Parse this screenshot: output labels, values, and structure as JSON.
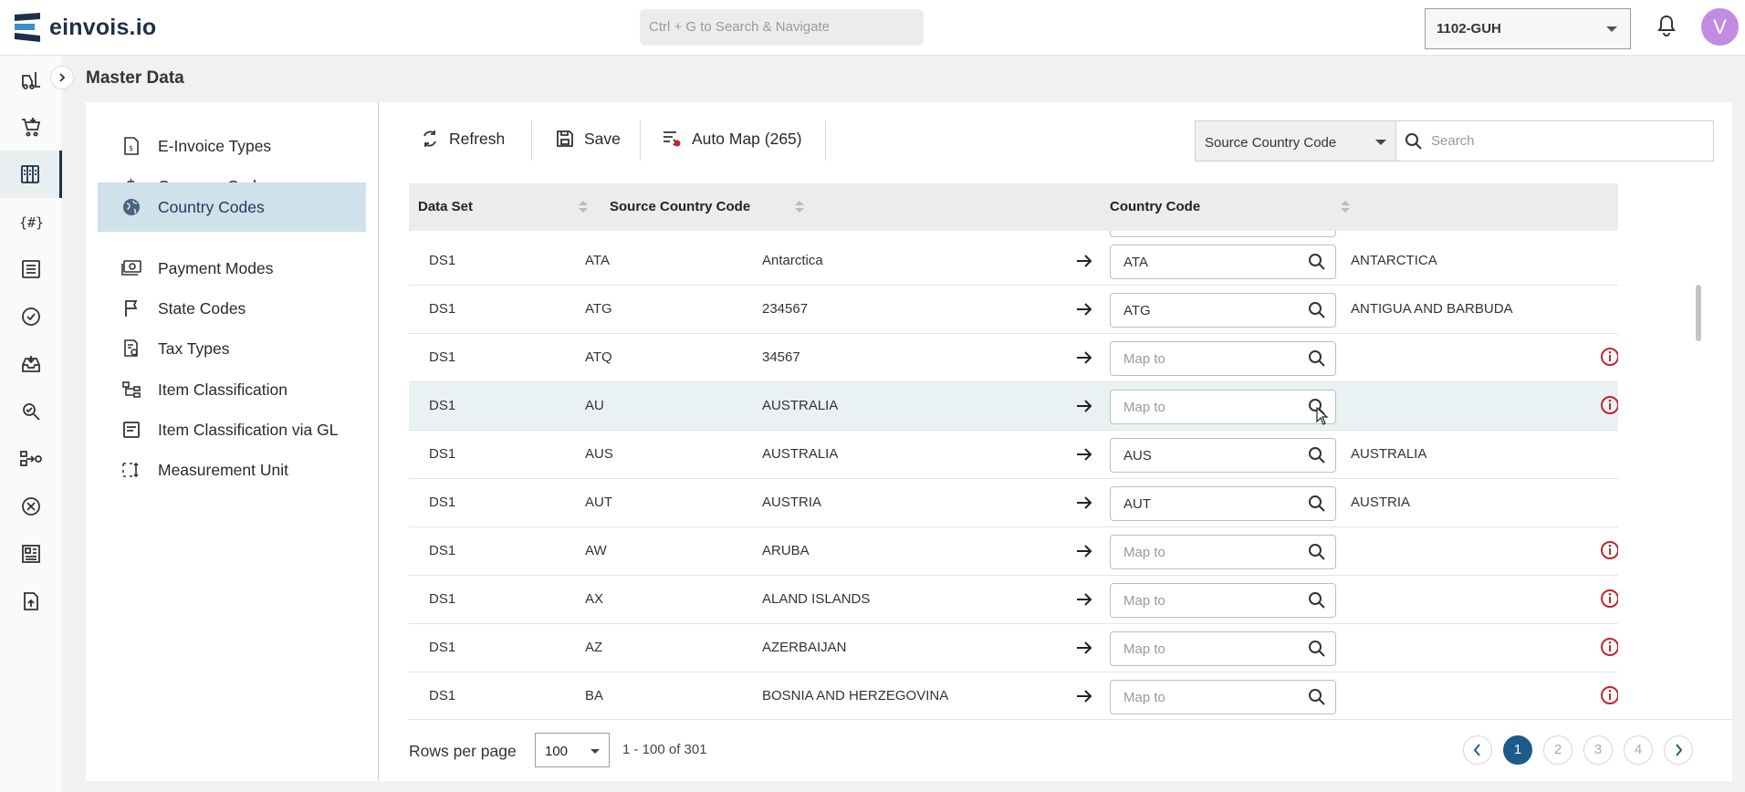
{
  "app": {
    "name": "einvois.io",
    "search_placeholder": "Ctrl + G to Search & Navigate",
    "company": "1102-GUH",
    "user_initial": "V"
  },
  "page": {
    "title": "Master Data"
  },
  "subnav": {
    "items": [
      {
        "label": "E-Invoice Types",
        "icon": "invoice-doc-icon",
        "active": false
      },
      {
        "label": "Currency Codes",
        "icon": "dollar-icon",
        "active": false
      },
      {
        "label": "Country Codes",
        "icon": "globe-icon",
        "active": true
      },
      {
        "label": "Payment Modes",
        "icon": "cash-icon",
        "active": false
      },
      {
        "label": "State Codes",
        "icon": "flag-icon",
        "active": false
      },
      {
        "label": "Tax Types",
        "icon": "tax-doc-icon",
        "active": false
      },
      {
        "label": "Item Classification",
        "icon": "hierarchy-icon",
        "active": false
      },
      {
        "label": "Item Classification via GL",
        "icon": "list-doc-icon",
        "active": false
      },
      {
        "label": "Measurement Unit",
        "icon": "measure-icon",
        "active": false
      }
    ]
  },
  "toolbar": {
    "refresh_label": "Refresh",
    "save_label": "Save",
    "automap_label": "Auto Map (265)",
    "filter_field": "Source Country Code",
    "search_placeholder": "Search"
  },
  "grid": {
    "headers": {
      "data_set": "Data Set",
      "source_country_code": "Source Country Code",
      "country_code": "Country Code"
    },
    "map_placeholder": "Map to",
    "rows": [
      {
        "data_set": "DS1",
        "source_code": "ATA",
        "source_name": "Antarctica",
        "mapped": "ATA",
        "mapped_name": "ANTARCTICA",
        "warning": false
      },
      {
        "data_set": "DS1",
        "source_code": "ATG",
        "source_name": "234567",
        "mapped": "ATG",
        "mapped_name": "ANTIGUA AND BARBUDA",
        "warning": false
      },
      {
        "data_set": "DS1",
        "source_code": "ATQ",
        "source_name": "34567",
        "mapped": "",
        "mapped_name": "",
        "warning": true
      },
      {
        "data_set": "DS1",
        "source_code": "AU",
        "source_name": "AUSTRALIA",
        "mapped": "",
        "mapped_name": "",
        "warning": true
      },
      {
        "data_set": "DS1",
        "source_code": "AUS",
        "source_name": "AUSTRALIA",
        "mapped": "AUS",
        "mapped_name": "AUSTRALIA",
        "warning": false
      },
      {
        "data_set": "DS1",
        "source_code": "AUT",
        "source_name": "AUSTRIA",
        "mapped": "AUT",
        "mapped_name": "AUSTRIA",
        "warning": false
      },
      {
        "data_set": "DS1",
        "source_code": "AW",
        "source_name": "ARUBA",
        "mapped": "",
        "mapped_name": "",
        "warning": true
      },
      {
        "data_set": "DS1",
        "source_code": "AX",
        "source_name": "ALAND ISLANDS",
        "mapped": "",
        "mapped_name": "",
        "warning": true
      },
      {
        "data_set": "DS1",
        "source_code": "AZ",
        "source_name": "AZERBAIJAN",
        "mapped": "",
        "mapped_name": "",
        "warning": true
      },
      {
        "data_set": "DS1",
        "source_code": "BA",
        "source_name": "BOSNIA AND HERZEGOVINA",
        "mapped": "",
        "mapped_name": "",
        "warning": true
      }
    ]
  },
  "pagination": {
    "rows_per_page_label": "Rows per page",
    "rows_per_page": "100",
    "range": "1 - 100 of 301",
    "pages": [
      "1",
      "2",
      "3",
      "4"
    ],
    "current_page": "1"
  },
  "colors": {
    "brand": "#1d3047",
    "active_nav": "#cfe1ea",
    "warning": "#c0262d",
    "page_active": "#1d5b8a"
  }
}
